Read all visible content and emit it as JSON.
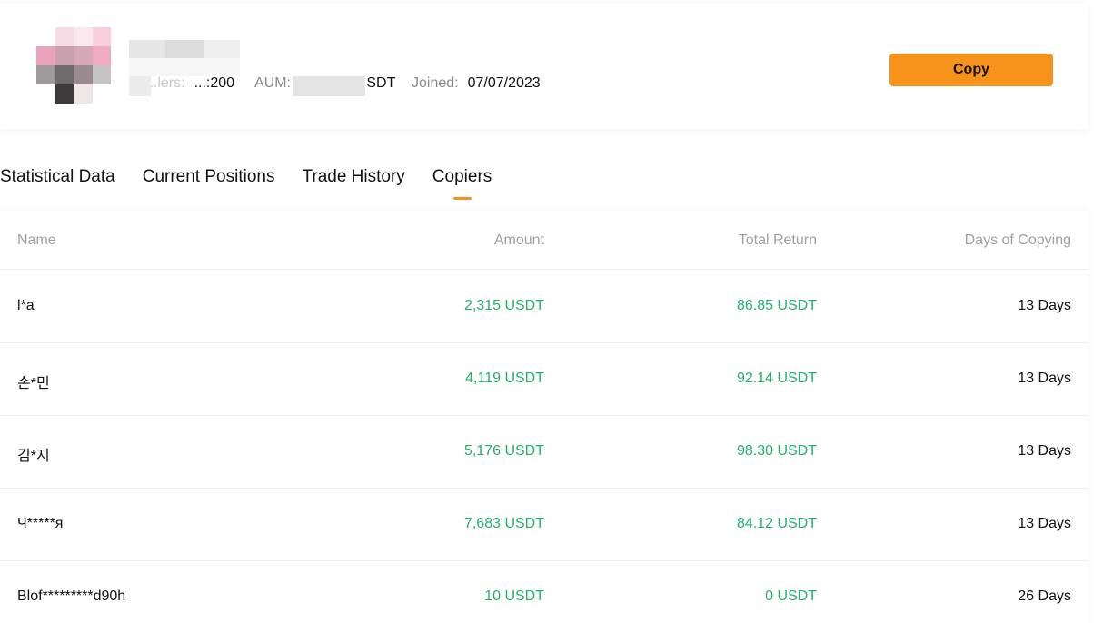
{
  "profile": {
    "followers_label": "...lers:",
    "followers_value": "...:200",
    "aum_label": "AUM:",
    "aum_value": "...SDT",
    "joined_label": "Joined:",
    "joined_value": "07/07/2023",
    "copy_button_label": "Copy",
    "accent_color": "#f7931a"
  },
  "tabs": [
    {
      "label": "Statistical Data",
      "active": false
    },
    {
      "label": "Current Positions",
      "active": false
    },
    {
      "label": "Trade History",
      "active": false
    },
    {
      "label": "Copiers",
      "active": true
    }
  ],
  "table": {
    "columns": [
      "Name",
      "Amount",
      "Total Return",
      "Days of Copying"
    ],
    "positive_color": "#20b26c",
    "rows": [
      {
        "name": "l*a",
        "amount": "2,315 USDT",
        "total_return": "86.85 USDT",
        "days": "13 Days"
      },
      {
        "name": "손*민",
        "amount": "4,119 USDT",
        "total_return": "92.14 USDT",
        "days": "13 Days"
      },
      {
        "name": "김*지",
        "amount": "5,176 USDT",
        "total_return": "98.30 USDT",
        "days": "13 Days"
      },
      {
        "name": "Ч*****я",
        "amount": "7,683 USDT",
        "total_return": "84.12 USDT",
        "days": "13 Days"
      },
      {
        "name": "Blof*********d90h",
        "amount": "10 USDT",
        "total_return": "0 USDT",
        "days": "26 Days"
      }
    ]
  }
}
